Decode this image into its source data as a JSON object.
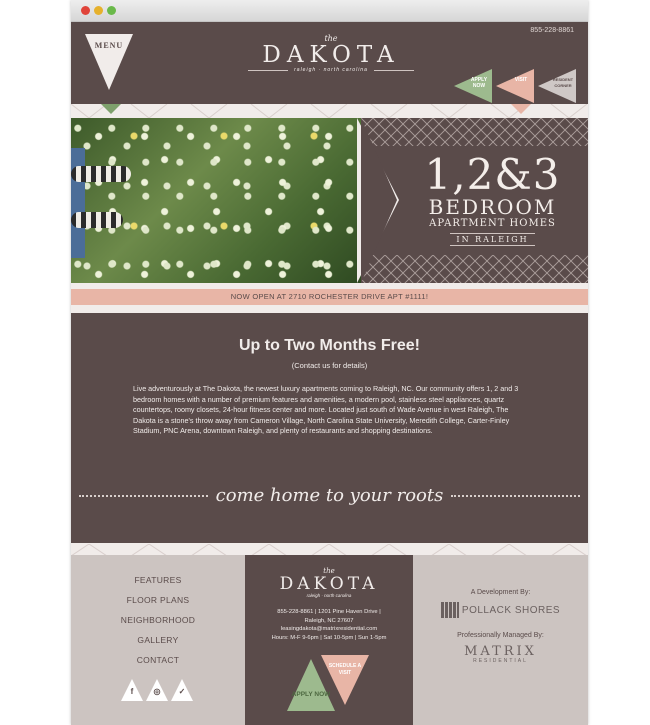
{
  "header": {
    "phone": "855-228-8861",
    "menu_label": "MENU",
    "logo_the": "the",
    "logo_name": "DAKOTA",
    "logo_sub": "raleigh · north carolina",
    "flags": [
      {
        "label": "APPLY NOW",
        "color": "#9dba8e"
      },
      {
        "label": "VISIT",
        "color": "#e8b5a6"
      },
      {
        "label": "RESIDENT CORNER",
        "color": "#cfc8c6"
      }
    ]
  },
  "hero": {
    "big": "1,2&3",
    "bedroom": "BEDROOM",
    "apartment": "APARTMENT HOMES",
    "location": "IN RALEIGH"
  },
  "announcement": "NOW OPEN AT 2710 ROCHESTER DRIVE APT #1111!",
  "content": {
    "heading": "Up to Two Months Free!",
    "contact_note": "(Contact us for details)",
    "body": "Live adventurously at The Dakota, the newest luxury apartments coming to Raleigh, NC. Our community offers 1, 2 and 3 bedroom homes with a number of premium features and amenities, a modern pool, stainless steel appliances, quartz countertops, roomy closets, 24-hour fitness center and more. Located just south of Wade Avenue in west Raleigh, The Dakota is a stone's throw away from Cameron Village, North Carolina State University, Meredith College, Carter-Finley Stadium, PNC Arena, downtown Raleigh, and plenty of restaurants and shopping destinations.",
    "tagline": "come home to your roots"
  },
  "footer": {
    "nav": [
      "FEATURES",
      "FLOOR PLANS",
      "NEIGHBORHOOD",
      "GALLERY",
      "CONTACT"
    ],
    "social": [
      {
        "name": "facebook",
        "glyph": "f"
      },
      {
        "name": "instagram",
        "glyph": "◎"
      },
      {
        "name": "twitter",
        "glyph": "✓"
      }
    ],
    "logo_the": "the",
    "logo_name": "DAKOTA",
    "logo_sub": "raleigh · north carolina",
    "info_line1": "855-228-8861 | 1201 Pine Haven Drive |",
    "info_line2": "Raleigh, NC 27607",
    "info_line3": "leasingdakota@matrixresidential.com",
    "info_line4": "Hours:  M-F 9-6pm | Sat 10-5pm | Sun 1-5pm",
    "apply_label": "APPLY NOW",
    "visit_label": "SCHEDULE A VISIT",
    "dev_label": "A Development By:",
    "dev_name": "POLLACK SHORES",
    "managed_label": "Professionally Managed By:",
    "manager_name": "MATRIX",
    "manager_sub": "RESIDENTIAL"
  },
  "colors": {
    "brown": "#5a4b4a",
    "cream": "#f1ecea",
    "pink": "#e8b5a6",
    "green": "#9dba8e",
    "taupe": "#ccc4c1"
  }
}
